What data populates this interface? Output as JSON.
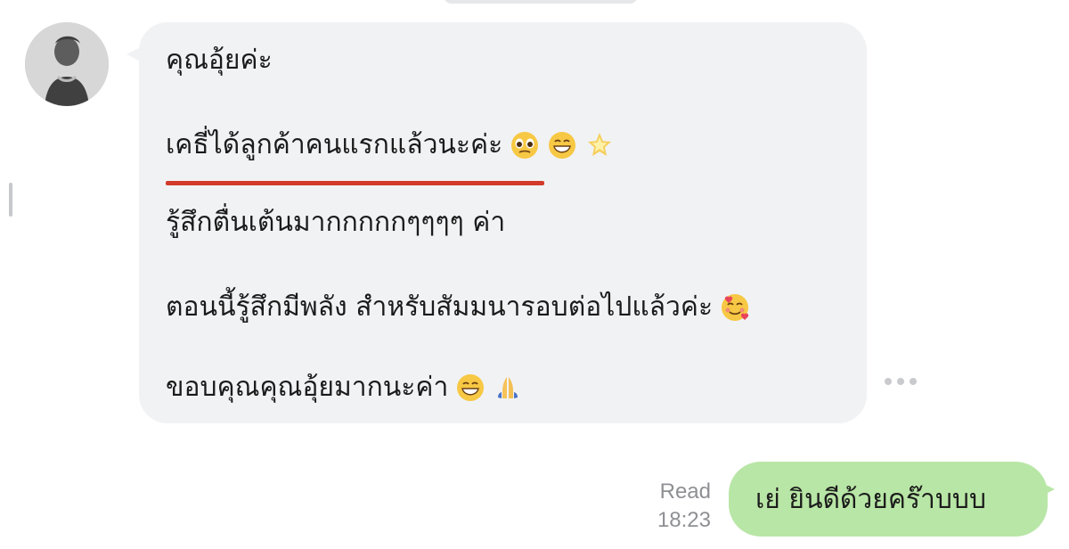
{
  "conversation": {
    "incoming": {
      "avatar_name": "contact-avatar",
      "lines": [
        "คุณอุ้ยค่ะ",
        "เคธี่ได้ลูกค้าคนแรกแล้วนะค่ะ",
        "รู้สึกตื่นเต้นมากกกกกๆๆๆๆ ค่า",
        "ตอนนี้รู้สึกมีพลัง สำหรับสัมมนารอบต่อไปแล้วค่ะ",
        "ขอบคุณคุณอุ้ยมากนะค่า"
      ],
      "emoji_names": {
        "line2": [
          "pleading-face-icon",
          "grinning-face-icon",
          "sparkle-star-icon"
        ],
        "line4": [
          "smiling-face-with-hearts-icon"
        ],
        "line5": [
          "grinning-face-icon",
          "folded-hands-icon"
        ]
      },
      "highlight_color": "#d23a2a"
    },
    "outgoing": {
      "read_label": "Read",
      "time": "18:23",
      "text": "เย่ ยินดีด้วยคร๊าบบบ",
      "bubble_color": "#b8e6a6"
    },
    "ui": {
      "incoming_bubble_color": "#f1f2f4",
      "more_icon": "more-horizontal-icon"
    }
  }
}
